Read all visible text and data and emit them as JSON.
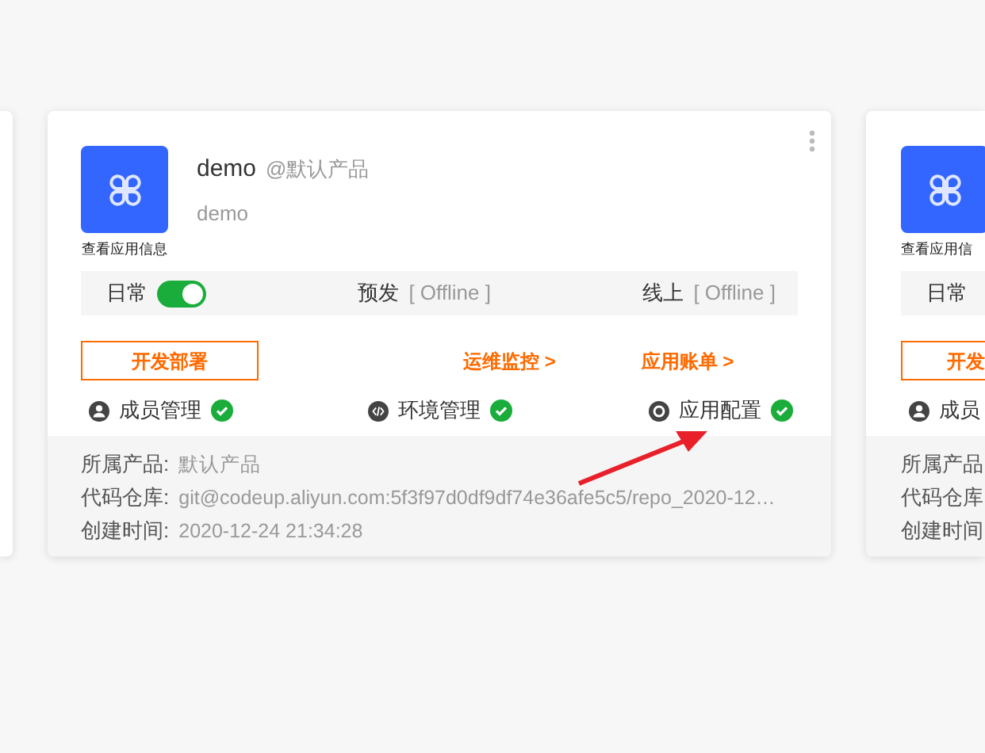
{
  "cards": [
    {
      "icon_caption": "查看应用信息",
      "name": "demo",
      "product_tag": "@默认产品",
      "description": "demo",
      "environments": [
        {
          "label": "日常",
          "kind": "toggle",
          "on": true
        },
        {
          "label": "预发",
          "kind": "status",
          "status": "[ Offline ]"
        },
        {
          "label": "线上",
          "kind": "status",
          "status": "[ Offline ]"
        }
      ],
      "deploy_button": "开发部署",
      "links": [
        "运维监控 >",
        "应用账单 >"
      ],
      "features": [
        {
          "kind": "member",
          "label": "成员管理",
          "done": true
        },
        {
          "kind": "environment",
          "label": "环境管理",
          "done": true
        },
        {
          "kind": "config",
          "label": "应用配置",
          "done": true
        }
      ],
      "details": [
        {
          "label": "所属产品:",
          "value": "默认产品"
        },
        {
          "label": "代码仓库:",
          "value": "git@codeup.aliyun.com:5f3f97d0df9df74e36afe5c5/repo_2020-12…"
        },
        {
          "label": "创建时间:",
          "value": "2020-12-24 21:34:28"
        }
      ]
    }
  ],
  "next_card": {
    "icon_caption": "查看应用信",
    "environment": "日常",
    "deploy_button": "开发",
    "feature": "成员",
    "details": [
      "所属产品",
      "代码仓库",
      "创建时间"
    ]
  }
}
